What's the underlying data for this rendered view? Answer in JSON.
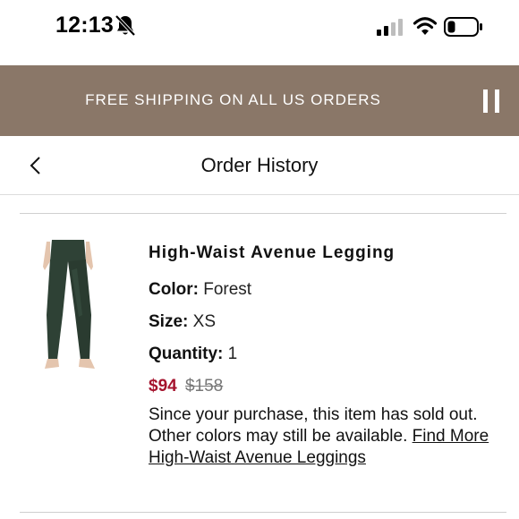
{
  "status_bar": {
    "time": "12:13"
  },
  "promo_banner": {
    "text": "FREE SHIPPING ON ALL US ORDERS",
    "background_color": "#8a7768"
  },
  "header": {
    "title": "Order History"
  },
  "order_item": {
    "name": "High-Waist Avenue Legging",
    "color_label": "Color:",
    "color_value": "Forest",
    "size_label": "Size:",
    "size_value": "XS",
    "quantity_label": "Quantity:",
    "quantity_value": "1",
    "sale_price": "$94",
    "original_price": "$158",
    "sale_price_color": "#a5132d",
    "sold_out_message": "Since your purchase, this item has sold out. Other colors may still be available.",
    "find_more_link": "Find More High-Waist Avenue Leggings"
  },
  "icons": [
    "bell-slash-icon",
    "cellular-signal-icon",
    "wifi-icon",
    "battery-icon",
    "pause-icon",
    "chevron-left-icon"
  ]
}
